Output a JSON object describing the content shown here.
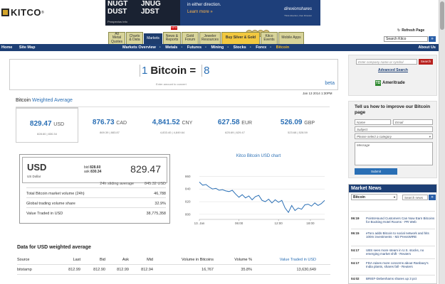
{
  "header": {
    "logo_text": "KITCO",
    "logo_reg": "®",
    "banner": {
      "ticker1_lines": [
        "NUGT",
        "DUST"
      ],
      "ticker2_lines": [
        "JNUG",
        "JDST"
      ],
      "prospectus": "Prospectus Info",
      "message": "in either direction.",
      "learn_more": "Learn more »",
      "brand": "direxionshares",
      "brand_sub": "Think direction, then Direxion"
    },
    "tabs": [
      {
        "label": "All Metal Quotes"
      },
      {
        "label": "Charts & Data"
      },
      {
        "label": "Markets"
      },
      {
        "label": "News & Reports"
      },
      {
        "label": "Gold Forum"
      },
      {
        "label": "Jeweler Resources"
      },
      {
        "label": "Buy Silver & Gold"
      },
      {
        "label": "Kitco Events"
      },
      {
        "label": "Mobile Apps"
      }
    ],
    "new_badge": "NEW",
    "refresh_label": "Refresh Page",
    "search_value": "Search Kitco",
    "search_go": "»"
  },
  "navbar": {
    "left_items": [
      "Home",
      "Site Map"
    ],
    "mid_items": [
      "Markets Overview",
      "Metals",
      "Futures",
      "Mining",
      "Stocks",
      "Forex",
      "Bitcoin"
    ],
    "separator": "•",
    "about": "About Us"
  },
  "converter": {
    "amount": "1",
    "label": "Bitcoin =",
    "result": "8",
    "hint": "Enter amount to convert",
    "beta": "beta",
    "timestamp": "Jan 13 2014 1:30PM"
  },
  "weighted": {
    "title_a": "Bitcoin",
    "title_b": "Weighted Average"
  },
  "quotes": [
    {
      "value": "829.47",
      "cur": "USD",
      "range": "828.60 | 830.34"
    },
    {
      "value": "876.73",
      "cur": "CAD",
      "range": "869.39 | 883.87"
    },
    {
      "value": "4,841.52",
      "cur": "CNY",
      "range": "4,833.40 | 4,849.64"
    },
    {
      "value": "627.58",
      "cur": "EUR",
      "range": "625.69 | 629.47"
    },
    {
      "value": "526.09",
      "cur": "GBP",
      "range": "523.68 | 528.59"
    }
  ],
  "usd": {
    "code": "USD",
    "name": "US Dollar",
    "bid_label": "bid",
    "bid": "828.60",
    "ask_label": "ask",
    "ask": "830.34",
    "price": "829.47",
    "sliding_label": "24h sliding average",
    "sliding_value": "845.32 USD",
    "rows": [
      {
        "label": "Total Bitcoin market volume (24h)",
        "value": "46,788"
      },
      {
        "label": "Global trading volume share",
        "value": "32.9%"
      },
      {
        "label": "Value Traded in USD",
        "value": "38,775,358"
      }
    ]
  },
  "chart_data": {
    "type": "line",
    "title": "Kitco Bitcoin USD chart",
    "x_ticks": [
      "13. Jan",
      "06:00",
      "12:00",
      "18:00"
    ],
    "y_ticks": [
      800,
      820,
      840,
      860
    ],
    "ylim": [
      792,
      866
    ],
    "points": [
      [
        0,
        851
      ],
      [
        3,
        846
      ],
      [
        6,
        847
      ],
      [
        9,
        843
      ],
      [
        12,
        840
      ],
      [
        15,
        841
      ],
      [
        18,
        838
      ],
      [
        21,
        839
      ],
      [
        24,
        837
      ],
      [
        27,
        836
      ],
      [
        30,
        838
      ],
      [
        33,
        832
      ],
      [
        36,
        827
      ],
      [
        39,
        831
      ],
      [
        42,
        826
      ],
      [
        45,
        829
      ],
      [
        48,
        823
      ],
      [
        51,
        828
      ],
      [
        54,
        830
      ],
      [
        57,
        822
      ],
      [
        60,
        820
      ],
      [
        63,
        824
      ],
      [
        66,
        818
      ],
      [
        69,
        823
      ],
      [
        72,
        819
      ],
      [
        75,
        822
      ],
      [
        78,
        810
      ],
      [
        81,
        803
      ],
      [
        84,
        814
      ],
      [
        87,
        806
      ],
      [
        90,
        810
      ],
      [
        93,
        808
      ],
      [
        96,
        815
      ],
      [
        99,
        816
      ],
      [
        102,
        813
      ],
      [
        105,
        818
      ],
      [
        108,
        814
      ],
      [
        111,
        817
      ],
      [
        114,
        822
      ]
    ],
    "x_range": [
      0,
      114
    ],
    "x_tick_positions": [
      0,
      36,
      72,
      101
    ],
    "line_color": "#2a6fb5"
  },
  "table": {
    "title": "Data for USD weighted average",
    "headers": [
      "Source",
      "Last",
      "Bid",
      "Ask",
      "Mid",
      "Volume in Bitcoins",
      "Volume %",
      "Value Traded in USD"
    ],
    "rows": [
      [
        "bitstamp",
        "812.99",
        "812.90",
        "812.99",
        "812.94",
        "16,767",
        "35.8%",
        "13,630,649"
      ]
    ]
  },
  "sidebar": {
    "company_placeholder": "Enter company name or symbol",
    "go": "Search",
    "advanced": "Advanced Search",
    "ad_logo": "TD",
    "ad_text": "Ameritrade",
    "feedback_title": "Tell us how to improve our Bitcoin page",
    "name_ph": "Name",
    "email_ph": "Email",
    "subject_ph": "Subject",
    "category_ph": "Please select a category",
    "message_ph": "Message",
    "submit": "Submit"
  },
  "market_news": {
    "title": "Market News",
    "select_value": "Bitcoin",
    "search_value": "Search news",
    "search_go": "»",
    "items": [
      {
        "time": "06:19",
        "headline": "PointsHound Customers Can Now Earn Bitcoins for Booking Hotel Rooms - PR Web"
      },
      {
        "time": "06:15",
        "headline": "eToro adds Bitcoin to social network and hits 100m investments - M2 PressWIRE"
      },
      {
        "time": "04:17",
        "headline": "UBS sees more steam in U.S. stocks, no emerging market shift - Reuters"
      },
      {
        "time": "04:17",
        "headline": "FDA raises more concerns about Ranbaxy's India plants, shares fall - Reuters"
      },
      {
        "time": "04:02",
        "headline": "BRIEF-Debenhams shares up 3 pct"
      }
    ]
  }
}
